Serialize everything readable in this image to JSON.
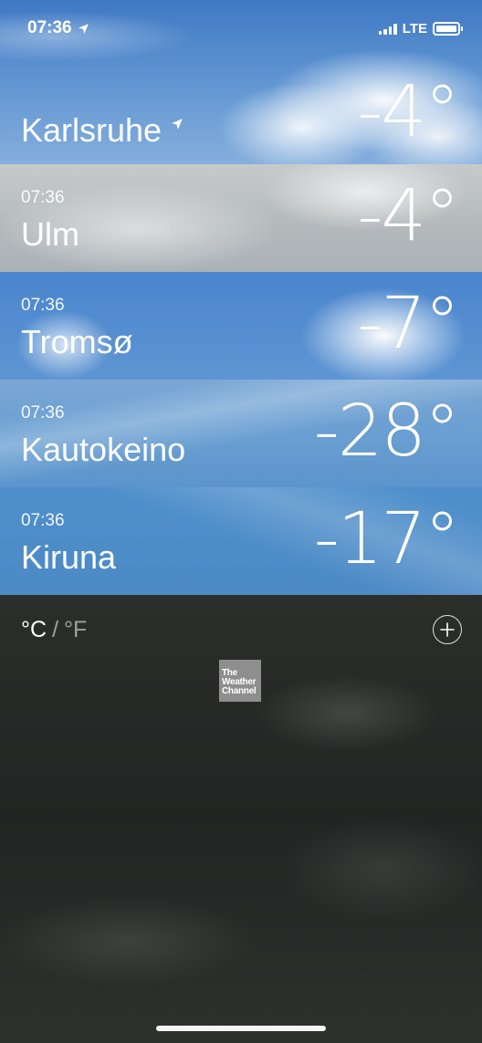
{
  "status_bar": {
    "time": "07:36",
    "network": "LTE",
    "icons": [
      "location-arrow-icon",
      "signal-bars-icon",
      "battery-icon"
    ]
  },
  "cities": [
    {
      "time": "",
      "name": "Karlsruhe",
      "temp": "-4°",
      "current_location": true
    },
    {
      "time": "07:36",
      "name": "Ulm",
      "temp": "-4°"
    },
    {
      "time": "07:36",
      "name": "Tromsø",
      "temp": "-7°"
    },
    {
      "time": "07:36",
      "name": "Kautokeino",
      "temp": "-28°"
    },
    {
      "time": "07:36",
      "name": "Kiruna",
      "temp": "-17°"
    }
  ],
  "units": {
    "celsius": "°C",
    "separator": "/",
    "fahrenheit": "°F",
    "selected": "°C"
  },
  "logo": {
    "line1": "The",
    "line2": "Weather",
    "line3": "Channel"
  },
  "add_button": {
    "icon": "plus-circle-icon"
  },
  "colors": {
    "text": "#ffffff",
    "bottom_bg": "#262827",
    "logo_bg": "#8e8e8e"
  }
}
